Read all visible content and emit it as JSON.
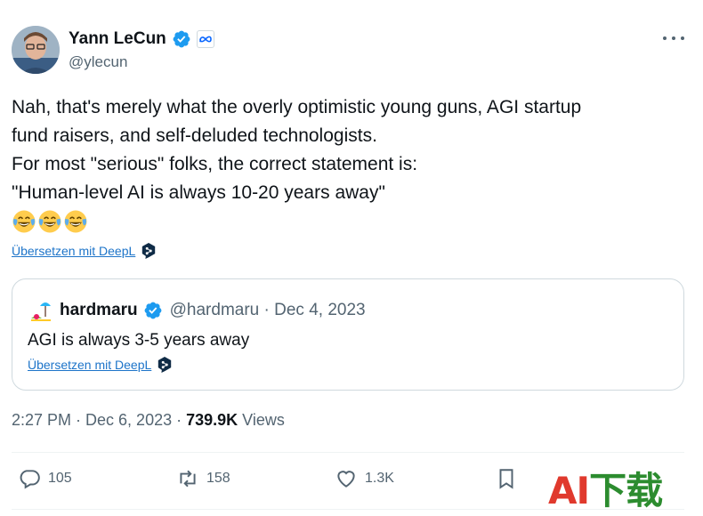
{
  "author": {
    "display_name": "Yann LeCun",
    "handle": "@ylecun",
    "verified_icon": "verified-badge-icon",
    "affiliation_icon": "meta-logo-icon"
  },
  "tweet": {
    "lines": [
      "Nah, that's merely what the overly optimistic young guns, AGI startup",
      "fund raisers, and self-deluded technologists.",
      "For most \"serious\" folks, the correct statement is:",
      "\"Human-level AI is always 10-20 years away\""
    ],
    "emojis": [
      "face-with-tears-of-joy",
      "face-with-tears-of-joy",
      "face-with-tears-of-joy"
    ],
    "translate_label": "Übersetzen mit DeepL"
  },
  "quoted": {
    "display_name": "hardmaru",
    "meta": "@hardmaru · Dec 4, 2023",
    "text": "AGI is always 3-5 years away",
    "translate_label": "Übersetzen mit DeepL"
  },
  "meta": {
    "time_date": "2:27 PM · Dec 6, 2023 · ",
    "views_count": "739.9K",
    "views_label": " Views"
  },
  "actions": {
    "replies": "105",
    "reposts": "158",
    "likes": "1.3K"
  },
  "watermark": {
    "a": "A",
    "i": "I",
    "rest": "下载"
  },
  "colors": {
    "link": "#1d74c9",
    "verified": "#1d9bf0",
    "secondary_text": "#536471"
  }
}
